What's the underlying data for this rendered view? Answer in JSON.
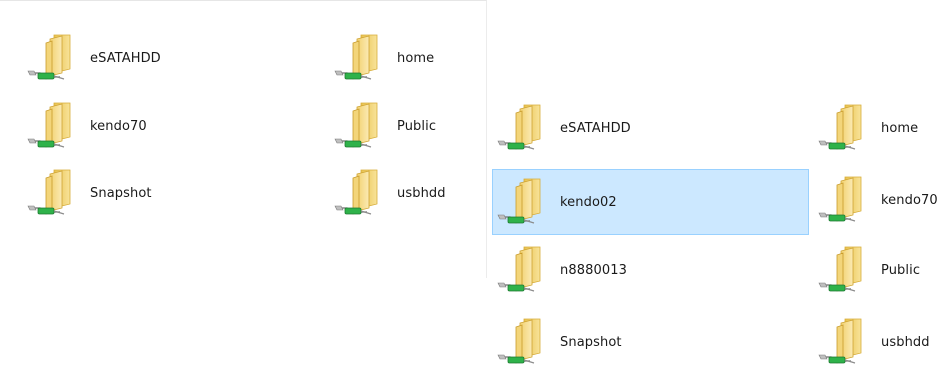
{
  "left_panel": {
    "items": [
      {
        "label": "eSATAHDD",
        "icon": "network-folder-icon"
      },
      {
        "label": "home",
        "icon": "network-folder-icon"
      },
      {
        "label": "kendo70",
        "icon": "network-folder-icon"
      },
      {
        "label": "Public",
        "icon": "network-folder-icon"
      },
      {
        "label": "Snapshot",
        "icon": "network-folder-icon"
      },
      {
        "label": "usbhdd",
        "icon": "network-folder-icon"
      }
    ]
  },
  "right_panel": {
    "items": [
      {
        "label": "eSATAHDD",
        "icon": "network-folder-icon"
      },
      {
        "label": "home",
        "icon": "network-folder-icon"
      },
      {
        "label": "kendo02",
        "icon": "network-folder-icon",
        "selected": true
      },
      {
        "label": "kendo70",
        "icon": "network-folder-icon"
      },
      {
        "label": "n8880013",
        "icon": "network-folder-icon"
      },
      {
        "label": "Public",
        "icon": "network-folder-icon"
      },
      {
        "label": "Snapshot",
        "icon": "network-folder-icon"
      },
      {
        "label": "usbhdd",
        "icon": "network-folder-icon"
      }
    ]
  },
  "colors": {
    "selection_fill": "#cce8ff",
    "selection_border": "#99d1ff",
    "folder_yellow": "#f3d57a",
    "network_green": "#2fb24a"
  }
}
